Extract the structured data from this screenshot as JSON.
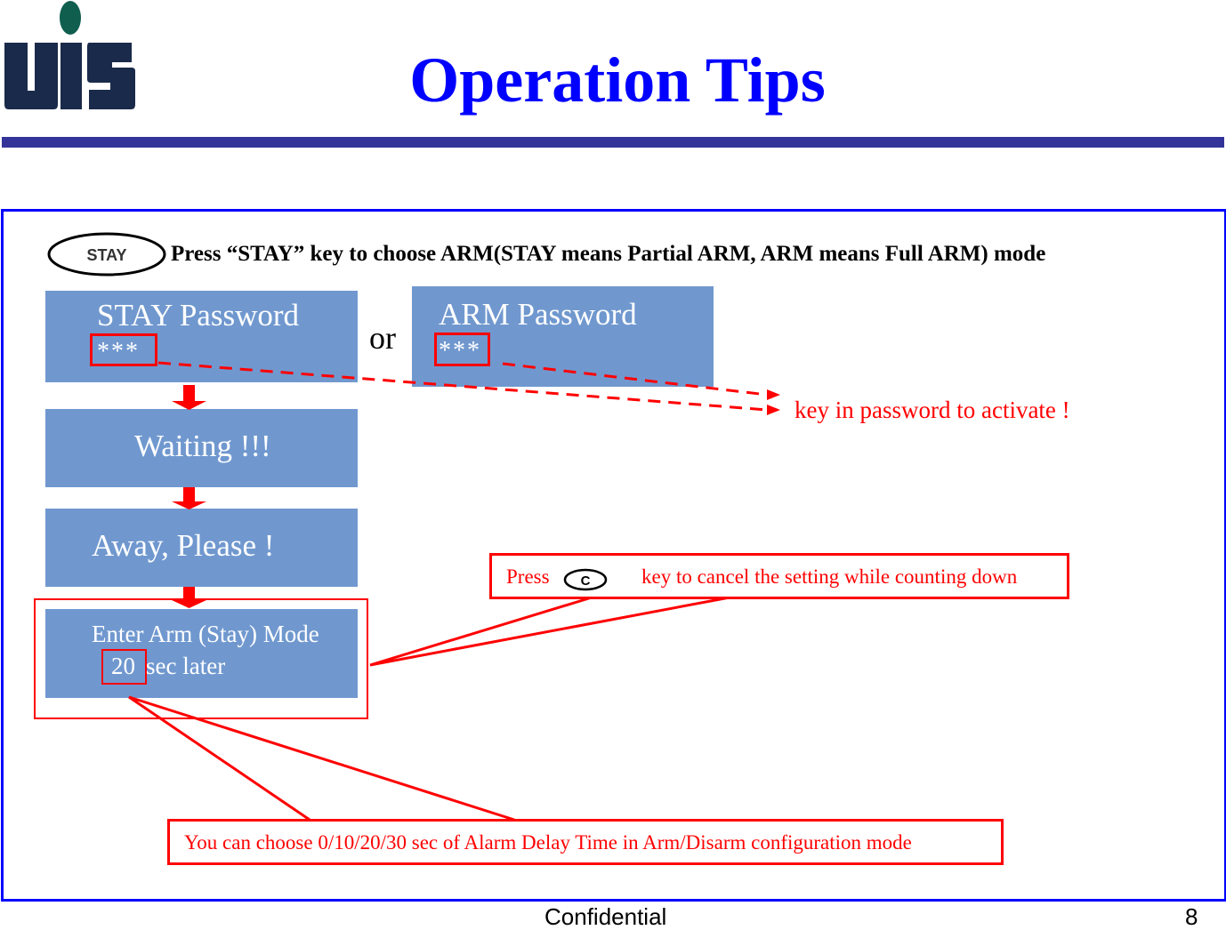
{
  "logo": {
    "text": "UIS",
    "letter_color": "#1a2a4a",
    "dot_color": "#0f5e4e"
  },
  "title": "Operation Tips",
  "colors": {
    "title": "#0000ff",
    "rule": "#333399",
    "frame": "#0000ff",
    "lcd_box": "#7098cf",
    "highlight": "#ff0000"
  },
  "instruction": {
    "key_label": "STAY",
    "text": "Press “STAY” key to choose ARM(STAY means Partial ARM, ARM means Full ARM) mode"
  },
  "flow": {
    "stay_box": {
      "title": "STAY Password",
      "input": "***"
    },
    "or_label": "or",
    "arm_box": {
      "title": "ARM Password",
      "input": "***"
    },
    "activate_note": "key in password to activate !",
    "waiting": "Waiting !!!",
    "away": "Away, Please !",
    "enter": {
      "line1": "Enter Arm (Stay) Mode",
      "delay": "20",
      "line2_suffix": "sec later"
    }
  },
  "callouts": {
    "cancel": {
      "prefix": "Press",
      "key_label": "C",
      "text": "key to cancel the setting while counting down"
    },
    "delay": {
      "text": "You can choose 0/10/20/30 sec of Alarm Delay Time in Arm/Disarm configuration mode"
    }
  },
  "footer": {
    "label": "Confidential",
    "page": "8"
  }
}
